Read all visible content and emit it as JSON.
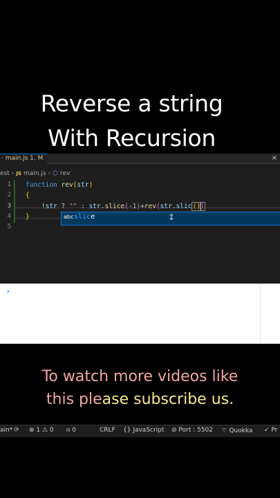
{
  "headline": {
    "line1": "Reverse a string",
    "line2": "With Recursion"
  },
  "tab": {
    "label": "· main.js 1, M",
    "close_glyph": "×"
  },
  "breadcrumb": {
    "root": "est",
    "js_badge": "JS",
    "file": "main.js",
    "symbol_glyph": "⬡",
    "symbol": "rev"
  },
  "editor": {
    "line_numbers": [
      "1",
      "2",
      "3",
      "4",
      "5"
    ]
  },
  "suggest": {
    "icon": "abc",
    "match": "slic",
    "rest": "e"
  },
  "statusbar": {
    "branch": "ain*",
    "sync_glyph": "⟳",
    "errors": "⊗ 1 ⚠ 0",
    "ports": "⍝ 0",
    "eol": "CRLF",
    "language": "{} JavaScript",
    "port": "⊘ Port : 5502",
    "quokka": "⌔ Quokka",
    "prettier": "✓ Pr"
  },
  "terminal": {
    "prompt": "›"
  },
  "footer": {
    "line1": "To watch more videos like",
    "line2_pink": "this ple",
    "line2_yellow": "ase subscribe us."
  },
  "colors": {
    "background": "#000000",
    "editor_bg": "#1e1e1e",
    "keyword": "#569cd6",
    "function": "#dcdcaa",
    "string": "#ce9178",
    "footer_pink": "#f2a6a6",
    "footer_yellow": "#f4e98c",
    "suggest_border": "#0a77d6"
  }
}
